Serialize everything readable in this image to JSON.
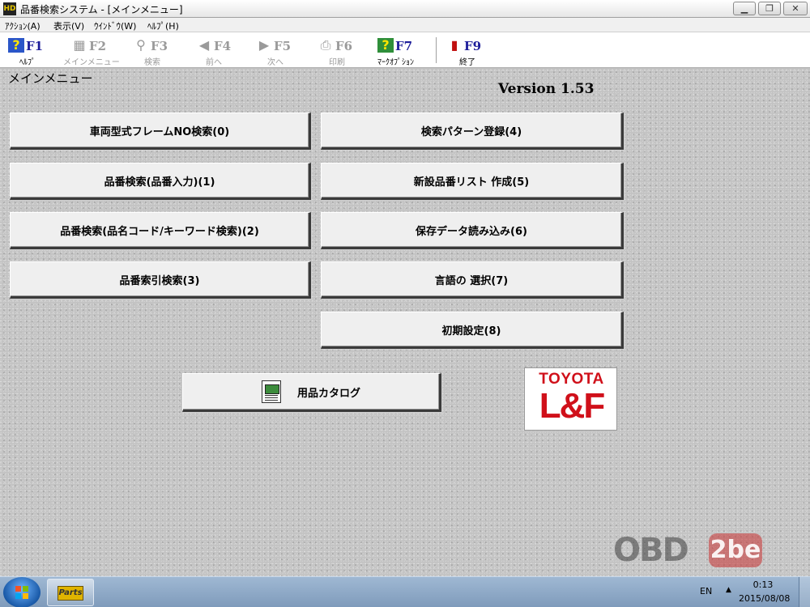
{
  "window": {
    "app_icon_text": "HD",
    "title": "品番検索システム - [メインメニュー]",
    "minimize": "▁",
    "restore": "❐",
    "close": "✕"
  },
  "menubar": {
    "items": [
      {
        "label": "ｱｸｼｮﾝ(A)"
      },
      {
        "label": "表示(V)"
      },
      {
        "label": "ｳｲﾝﾄﾞｳ(W)"
      },
      {
        "label": "ﾍﾙﾌﾟ(H)"
      }
    ]
  },
  "toolbar": {
    "items": [
      {
        "key": "F1",
        "label": "ﾍﾙﾌﾟ",
        "icon": "?",
        "enabled": true
      },
      {
        "key": "F2",
        "label": "メインメニュー",
        "icon": "▦",
        "enabled": false
      },
      {
        "key": "F3",
        "label": "検索",
        "icon": "⚲",
        "enabled": false
      },
      {
        "key": "F4",
        "label": "前へ",
        "icon": "◀",
        "enabled": false
      },
      {
        "key": "F5",
        "label": "次へ",
        "icon": "▶",
        "enabled": false
      },
      {
        "key": "F6",
        "label": "印刷",
        "icon": "⎙",
        "enabled": false
      },
      {
        "key": "F7",
        "label": "ﾏｰｸｵﾌﾟｼｮﾝ",
        "icon": "?",
        "enabled": true
      },
      {
        "key": "F9",
        "label": "終了",
        "icon": "▮",
        "enabled": true
      }
    ]
  },
  "main": {
    "title": "メインメニュー",
    "version": "Version   1.53",
    "buttons": {
      "b0": "車両型式フレームNO検索(0)",
      "b1": "品番検索(品番入力)(1)",
      "b2": "品番検索(品名コード/キーワード検索)(2)",
      "b3": "品番索引検索(3)",
      "b4": "検索パターン登録(4)",
      "b5": "新設品番リスト 作成(5)",
      "b6": "保存データ読み込み(6)",
      "b7": "言語の 選択(7)",
      "b8": "初期設定(8)",
      "catalog": "用品カタログ"
    },
    "logo": {
      "line1": "TOYOTA",
      "line2": "L&F"
    },
    "watermark": {
      "part1": "OBD",
      "part2": "2be"
    }
  },
  "taskbar": {
    "app_label": "Parts",
    "lang": "EN",
    "tray_arrow": "▲",
    "time": "0:13",
    "date": "2015/08/08"
  },
  "colors": {
    "toolbar_key_enabled": "#1d1d9a",
    "disabled": "#9a9a9a",
    "logo_red": "#d0101a"
  }
}
